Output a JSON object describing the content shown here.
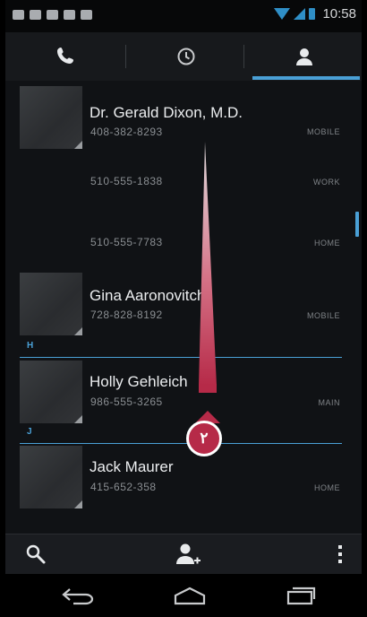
{
  "status_bar": {
    "time": "10:58",
    "notification_icons": [
      "chat-icon",
      "mail-icon",
      "voicemail-icon",
      "shopping-bag-icon",
      "shopping-bag-icon"
    ]
  },
  "tabs": [
    {
      "name": "phone-icon"
    },
    {
      "name": "clock-icon"
    },
    {
      "name": "person-icon",
      "selected": true
    }
  ],
  "contacts": [
    {
      "name": "Dr. Gerald Dixon, M.D.",
      "numbers": [
        {
          "number": "408-382-8293",
          "type": "MOBILE"
        },
        {
          "number": "510-555-1838",
          "type": "WORK"
        },
        {
          "number": "510-555-7783",
          "type": "HOME"
        }
      ]
    },
    {
      "name": "Gina Aaronovitch",
      "numbers": [
        {
          "number": "728-828-8192",
          "type": "MOBILE"
        }
      ]
    },
    {
      "section": "H",
      "name": "Holly Gehleich",
      "numbers": [
        {
          "number": "986-555-3265",
          "type": "MAIN"
        }
      ]
    },
    {
      "section": "J",
      "name": "Jack Maurer",
      "numbers": [
        {
          "number": "415-652-358",
          "type": "HOME"
        }
      ]
    }
  ],
  "annotation": {
    "badge": "٢",
    "color": "#b62a48"
  },
  "action_bar": [
    "search-icon",
    "add-contact-icon",
    "overflow-menu-icon"
  ],
  "nav_bar": [
    "back-icon",
    "home-icon",
    "recent-apps-icon"
  ],
  "colors": {
    "accent": "#4aa0d6",
    "background": "#121418"
  }
}
